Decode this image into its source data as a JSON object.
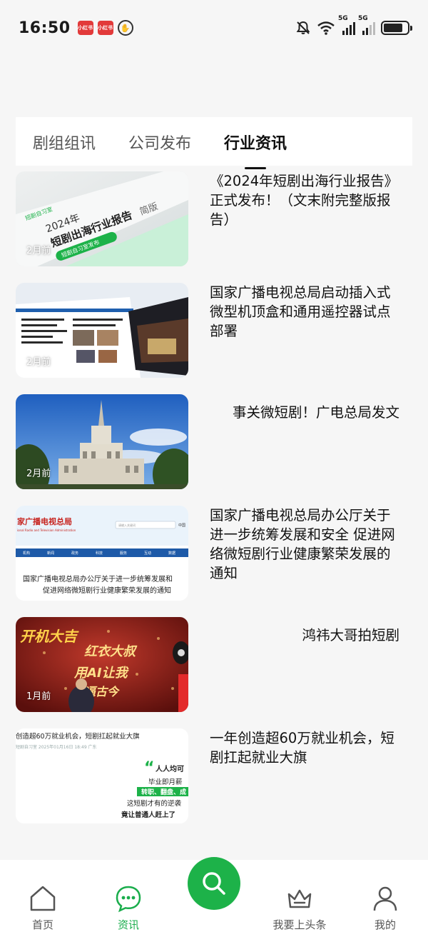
{
  "status_bar": {
    "time": "16:50",
    "badges": [
      "小红书",
      "小红书"
    ],
    "network": "5G"
  },
  "tabs": [
    {
      "label": "剧组组讯",
      "active": false
    },
    {
      "label": "公司发布",
      "active": false
    },
    {
      "label": "行业资讯",
      "active": true
    }
  ],
  "news": [
    {
      "title": "《2024年短剧出海行业报告》正式发布！（文末附完整版报告）",
      "time": "2月前"
    },
    {
      "title": "国家广播电视总局启动插入式微型机顶盒和通用遥控器试点部署",
      "time": "2月前"
    },
    {
      "title": "事关微短剧！广电总局发文",
      "time": "2月前"
    },
    {
      "title": "国家广播电视总局办公厅关于进一步统筹发展和安全 促进网络微短剧行业健康繁荣发展的通知",
      "time": ""
    },
    {
      "title": "鸿祎大哥拍短剧",
      "time": "1月前"
    },
    {
      "title": "一年创造超60万就业机会，短剧扛起就业大旗",
      "time": ""
    }
  ],
  "thumb_text": {
    "t1_brand": "短剧自习室",
    "t1_year": "2024年",
    "t1_main": "短剧出海行业报告",
    "t1_suffix": "简版",
    "t1_pill": "短剧自习室发布",
    "t4_header": "家广播电视总局",
    "t4_sub": "ional Radio and Television Administration",
    "t4_nav": [
      "机构",
      "新闻",
      "政务",
      "科技",
      "服务",
      "互动",
      "数据"
    ],
    "t4_search": "请输入关键词",
    "t4_lang": "中国",
    "t4_line1": "国家广播电视总局办公厅关于进一步统筹发展和",
    "t4_line2": "促进网络微短剧行业健康繁荣发展的通知",
    "t5_line1": "开机大吉",
    "t5_line2": "红衣大叔",
    "t5_line3": "用AI让我",
    "t5_line4": "逼古今",
    "t6_headline": "创造超60万就业机会，短剧扛起就业大旗",
    "t6_meta": "短剧自习室  2025年01月16日 18:49  广东",
    "t6_quote": "人人均可",
    "t6_l1": "毕业即月薪",
    "t6_l2": "转职、翻盘、成",
    "t6_l3": "这短剧才有的逆袭",
    "t6_l4": "竟让普通人赶上了"
  },
  "bottom_nav": [
    {
      "label": "首页",
      "icon": "home-icon",
      "active": false
    },
    {
      "label": "资讯",
      "icon": "chat-icon",
      "active": true
    },
    {
      "label": "我要上头条",
      "icon": "crown-icon",
      "active": false
    },
    {
      "label": "我的",
      "icon": "user-icon",
      "active": false
    }
  ],
  "colors": {
    "accent": "#1db249",
    "active_text": "#1aad4c"
  }
}
